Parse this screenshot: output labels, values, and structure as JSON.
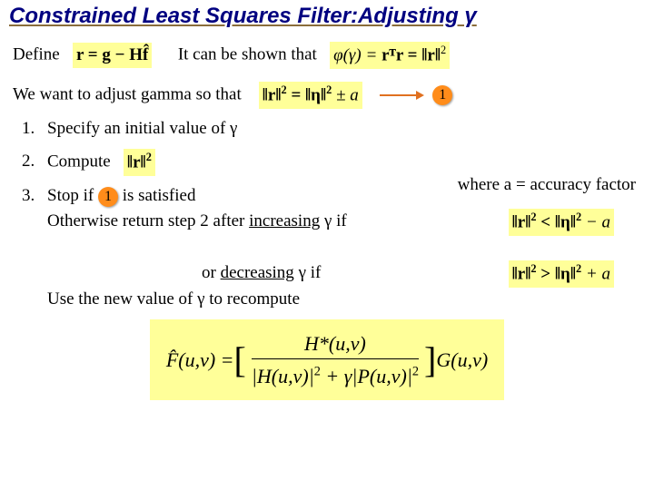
{
  "title": "Constrained Least Squares Filter:Adjusting γ",
  "line1": {
    "define": "Define",
    "eq1": "r = g − Hf̂",
    "shown": "It can be shown that",
    "eq2_lhs": "φ(γ) = ",
    "eq2_mid": "rᵀr = ",
    "eq2_r": "‖r‖",
    "eq2_sup": "2"
  },
  "line2": {
    "text": "We want to adjust gamma so that",
    "eq_lhs": "‖r‖",
    "eq_sup": "2",
    "eq_eq": " = ",
    "eq_rhs": "‖η‖",
    "eq_pm": " ± a",
    "badge": "1"
  },
  "accuracy": "where a = accuracy factor",
  "steps": {
    "one_num": "1.",
    "one_text": "Specify an initial value of γ",
    "two_num": "2.",
    "two_text": "Compute",
    "two_eq": "‖r‖",
    "two_sup": "2",
    "three_num": "3.",
    "three_a": "Stop if ",
    "three_badge": "1",
    "three_b": "  is satisfied",
    "three_c": "Otherwise return step 2 after ",
    "three_inc": "increasing",
    "three_d": " γ if",
    "three_eq1_l": "‖r‖",
    "three_eq1_s": "2",
    "three_eq1_m": " < ",
    "three_eq1_r": "‖η‖",
    "three_eq1_t": " − a",
    "three_e": "or ",
    "three_dec": "decreasing",
    "three_f": " γ if",
    "three_eq2_l": "‖r‖",
    "three_eq2_s": "2",
    "three_eq2_m": " > ",
    "three_eq2_r": "‖η‖",
    "three_eq2_t": " + a",
    "three_g": "Use the new value of γ to recompute"
  },
  "final": {
    "lhs": "F̂(u,v) = ",
    "lbrack": "[",
    "num": "H*(u,v)",
    "den_a": "|H(u,v)|",
    "den_s": "2",
    "den_b": " + γ|P(u,v)|",
    "rbrack": "]",
    "tail": " G(u,v)"
  }
}
